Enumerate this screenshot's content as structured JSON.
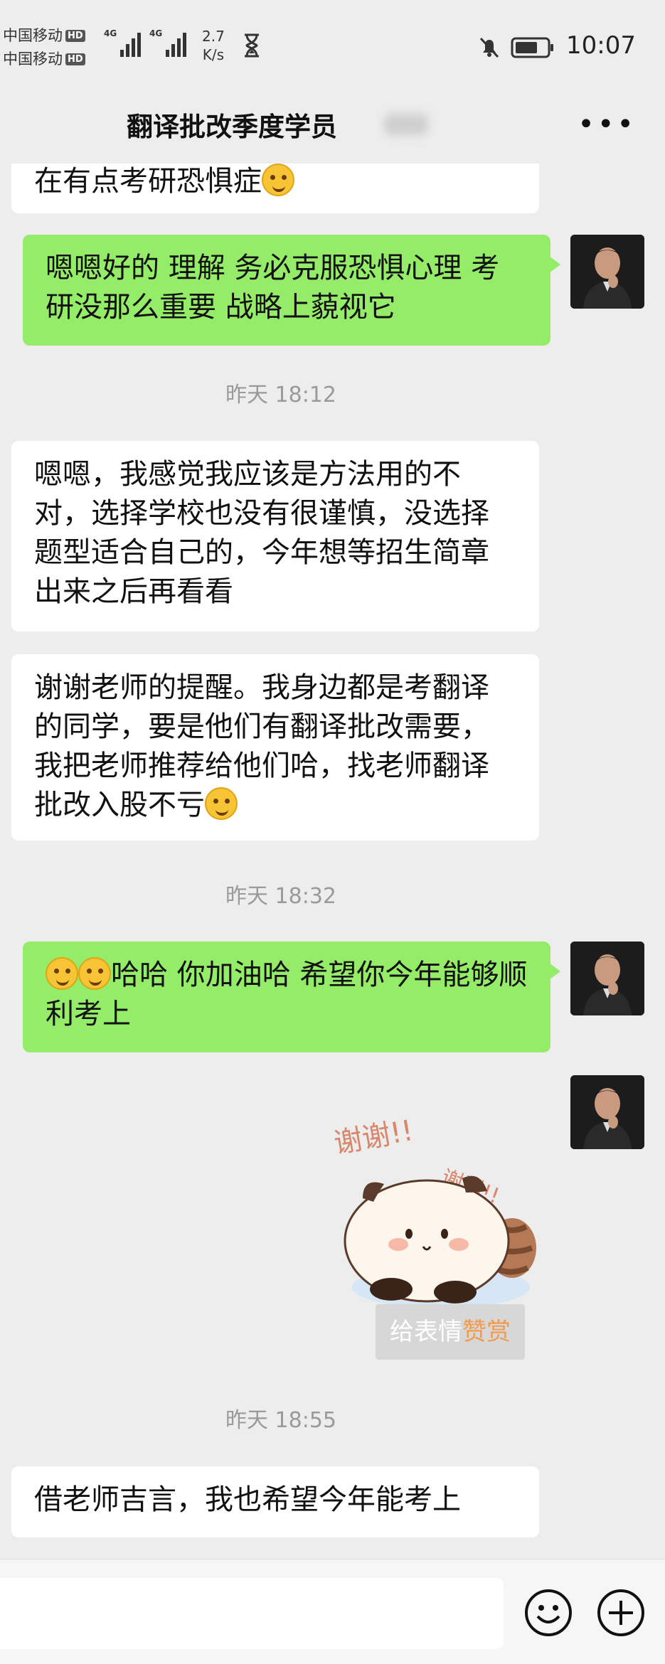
{
  "status_bar": {
    "carrier1": "中国移动",
    "carrier2": "中国移动",
    "hd_badge": "HD",
    "net1": "4G",
    "net2": "4G",
    "speed_value": "2.7",
    "speed_unit": "K/s",
    "time": "10:07"
  },
  "header": {
    "title": "翻译批改季度学员",
    "more_icon": "more-dots-icon"
  },
  "messages": [
    {
      "side": "left",
      "text": "在有点考研恐惧症",
      "emoji": "laughing-crying-emoji"
    },
    {
      "side": "right",
      "text": "嗯嗯好的 理解 务必克服恐惧心理 考研没那么重要 战略上藐视它"
    },
    {
      "type": "timestamp",
      "text": "昨天 18:12"
    },
    {
      "side": "left",
      "text": "嗯嗯，我感觉我应该是方法用的不对，选择学校也没有很谨慎，没选择题型适合自己的，今年想等招生简章出来之后再看看"
    },
    {
      "side": "left",
      "text": "谢谢老师的提醒。我身边都是考翻译的同学，要是他们有翻译批改需要，我把老师推荐给他们哈，找老师翻译批改入股不亏",
      "emoji": "wink-emoji"
    },
    {
      "type": "timestamp",
      "text": "昨天 18:32"
    },
    {
      "side": "right",
      "text": "哈哈 你加油哈 希望你今年能够顺利考上",
      "emoji": "shy-laugh-emoji"
    },
    {
      "side": "right",
      "type": "sticker",
      "sticker_text1": "谢谢!!",
      "sticker_text2": "谢谢!!"
    },
    {
      "type": "reward",
      "text": "给表情",
      "highlight": "赞赏"
    },
    {
      "type": "timestamp",
      "text": "昨天 18:55"
    },
    {
      "side": "left",
      "text": "借老师吉言，我也希望今年能考上"
    }
  ],
  "input_bar": {
    "emoji_icon": "smile-icon",
    "plus_icon": "plus-icon"
  },
  "colors": {
    "background": "#ededed",
    "self_bubble": "#95ec69",
    "other_bubble": "#ffffff",
    "reward_highlight": "#f29b4c"
  }
}
